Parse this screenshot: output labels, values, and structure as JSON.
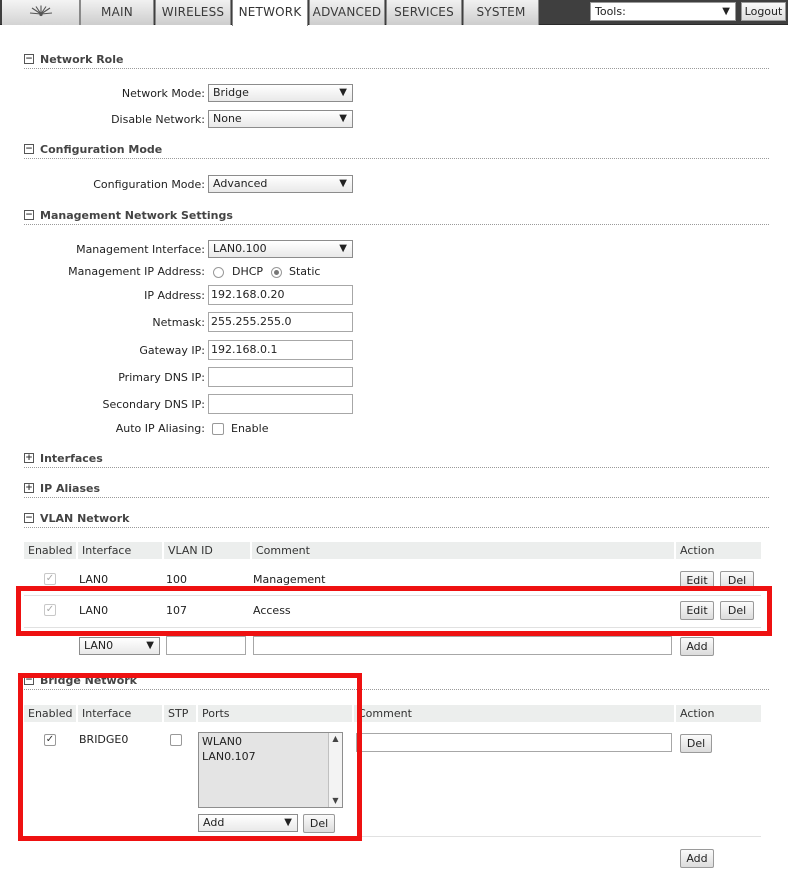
{
  "nav": {
    "tabs": [
      {
        "label": "MAIN"
      },
      {
        "label": "WIRELESS"
      },
      {
        "label": "NETWORK"
      },
      {
        "label": "ADVANCED"
      },
      {
        "label": "SERVICES"
      },
      {
        "label": "SYSTEM"
      }
    ],
    "active_tab": "NETWORK",
    "tools_label": "Tools:",
    "logout_label": "Logout"
  },
  "network_role": {
    "title": "Network Role",
    "network_mode_label": "Network Mode:",
    "network_mode_value": "Bridge",
    "disable_network_label": "Disable Network:",
    "disable_network_value": "None"
  },
  "configuration_mode": {
    "title": "Configuration Mode",
    "label": "Configuration Mode:",
    "value": "Advanced"
  },
  "management": {
    "title": "Management Network Settings",
    "interface_label": "Management Interface:",
    "interface_value": "LAN0.100",
    "ip_address_mode_label": "Management IP Address:",
    "dhcp_label": "DHCP",
    "static_label": "Static",
    "selected_mode": "Static",
    "ip_label": "IP Address:",
    "ip_value": "192.168.0.20",
    "netmask_label": "Netmask:",
    "netmask_value": "255.255.255.0",
    "gateway_label": "Gateway IP:",
    "gateway_value": "192.168.0.1",
    "primary_dns_label": "Primary DNS IP:",
    "primary_dns_value": "",
    "secondary_dns_label": "Secondary DNS IP:",
    "secondary_dns_value": "",
    "auto_alias_label": "Auto IP Aliasing:",
    "auto_alias_enable_label": "Enable",
    "auto_alias_checked": false
  },
  "interfaces": {
    "title": "Interfaces"
  },
  "ip_aliases": {
    "title": "IP Aliases"
  },
  "vlan": {
    "title": "VLAN Network",
    "columns": {
      "enabled": "Enabled",
      "interface": "Interface",
      "vlan_id": "VLAN ID",
      "comment": "Comment",
      "action": "Action"
    },
    "rows": [
      {
        "enabled": true,
        "interface": "LAN0",
        "vlan_id": "100",
        "comment": "Management",
        "edit": "Edit",
        "del": "Del"
      },
      {
        "enabled": true,
        "interface": "LAN0",
        "vlan_id": "107",
        "comment": "Access",
        "edit": "Edit",
        "del": "Del"
      }
    ],
    "new_row": {
      "interface_value": "LAN0",
      "vlan_id_value": "",
      "comment_value": "",
      "add_label": "Add"
    }
  },
  "bridge": {
    "title": "Bridge Network",
    "columns": {
      "enabled": "Enabled",
      "interface": "Interface",
      "stp": "STP",
      "ports": "Ports",
      "comment": "Comment",
      "action": "Action"
    },
    "row": {
      "enabled": true,
      "interface": "BRIDGE0",
      "stp": false,
      "ports": [
        "WLAN0",
        "LAN0.107"
      ],
      "port_add_value": "Add",
      "port_del_label": "Del",
      "comment_value": "",
      "del_label": "Del"
    },
    "add_label": "Add"
  },
  "colors": {
    "highlight": "#ee1111",
    "topbar": "#3f3f3f"
  }
}
